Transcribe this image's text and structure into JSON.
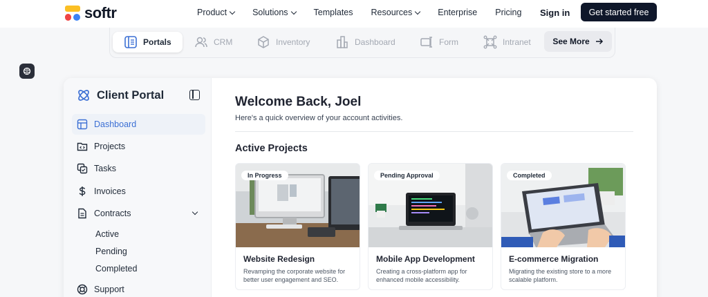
{
  "brand": {
    "name": "softr"
  },
  "topnav": {
    "links": [
      {
        "label": "Product",
        "dropdown": true
      },
      {
        "label": "Solutions",
        "dropdown": true
      },
      {
        "label": "Templates",
        "dropdown": false
      },
      {
        "label": "Resources",
        "dropdown": true
      },
      {
        "label": "Enterprise",
        "dropdown": false
      },
      {
        "label": "Pricing",
        "dropdown": false
      }
    ],
    "signin": "Sign in",
    "cta": "Get started free"
  },
  "template_tabs": {
    "items": [
      {
        "label": "Portals",
        "icon": "portal-icon",
        "active": true
      },
      {
        "label": "CRM",
        "icon": "users-icon",
        "active": false
      },
      {
        "label": "Inventory",
        "icon": "box-icon",
        "active": false
      },
      {
        "label": "Dashboard",
        "icon": "building-icon",
        "active": false
      },
      {
        "label": "Form",
        "icon": "form-icon",
        "active": false
      },
      {
        "label": "Intranet",
        "icon": "network-icon",
        "active": false
      }
    ],
    "see_more": "See More"
  },
  "portal": {
    "title": "Client Portal",
    "nav": [
      {
        "label": "Dashboard",
        "icon": "layout-icon",
        "active": true
      },
      {
        "label": "Projects",
        "icon": "folder-code-icon",
        "active": false
      },
      {
        "label": "Tasks",
        "icon": "tasks-icon",
        "active": false
      },
      {
        "label": "Invoices",
        "icon": "dollar-icon",
        "active": false
      },
      {
        "label": "Contracts",
        "icon": "document-icon",
        "active": false,
        "expanded": true
      }
    ],
    "contracts_sub": [
      "Active",
      "Pending",
      "Completed"
    ],
    "support": "Support"
  },
  "main": {
    "welcome": "Welcome Back, Joel",
    "overview": "Here's a quick overview of your account activities.",
    "section_title": "Active Projects",
    "projects": [
      {
        "status": "In Progress",
        "title": "Website Redesign",
        "description": "Revamping the corporate website for better user engagement and SEO."
      },
      {
        "status": "Pending Approval",
        "title": "Mobile App Development",
        "description": "Creating a cross-platform app for enhanced mobile accessibility."
      },
      {
        "status": "Completed",
        "title": "E-commerce Migration",
        "description": "Migrating the existing store to a more scalable platform."
      }
    ]
  },
  "colors": {
    "accent": "#3b6fd4",
    "cta_bg": "#0f172a",
    "logo_yellow": "#fbbf24",
    "logo_red": "#ef4444",
    "logo_blue": "#3b82f6"
  }
}
